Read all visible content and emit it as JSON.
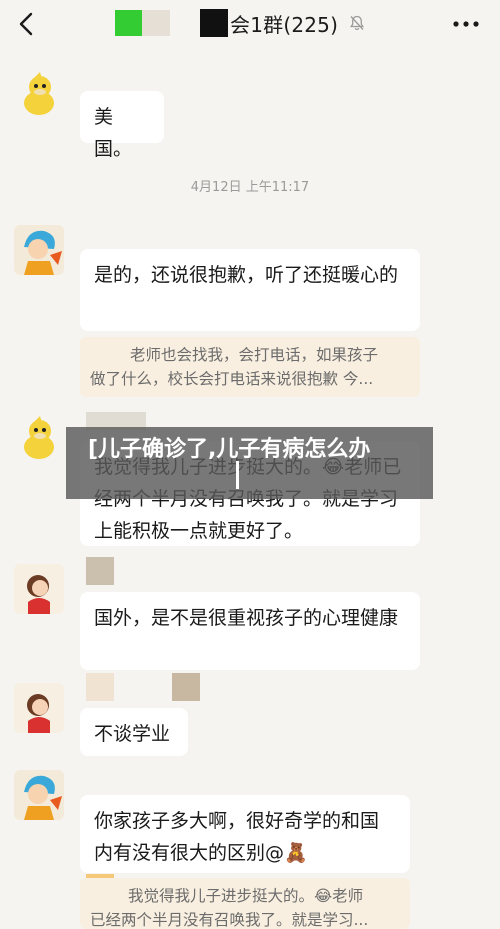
{
  "header": {
    "group_name": "会1群(225)"
  },
  "messages": [
    {
      "text": "美国。"
    },
    {
      "text": "是的，还说很抱歉，听了还挺暖心的"
    },
    {
      "text": "我觉得我儿子进步挺大的。😂老师已经两个半月没有召唤我了。就是学习上能积极一点就更好了。"
    },
    {
      "text": "国外，是不是很重视孩子的心理健康"
    },
    {
      "text": "不谈学业"
    },
    {
      "text": "你家孩子多大啊，很好奇学的和国内有没有很大的区别@🧸"
    }
  ],
  "timestamp": "4月12日 上午11:17",
  "quote_1": {
    "line1": "老师也会找我，会打电话，如果孩子",
    "line2": "做了什么，校长会打电话来说很抱歉 今..."
  },
  "quote_2": {
    "line1": "我觉得我儿子进步挺大的。😂老师",
    "line2": "已经两个半月没有召唤我了。就是学习..."
  },
  "overlay_banner": {
    "text": "[儿子确诊了,儿子有病怎么办"
  }
}
